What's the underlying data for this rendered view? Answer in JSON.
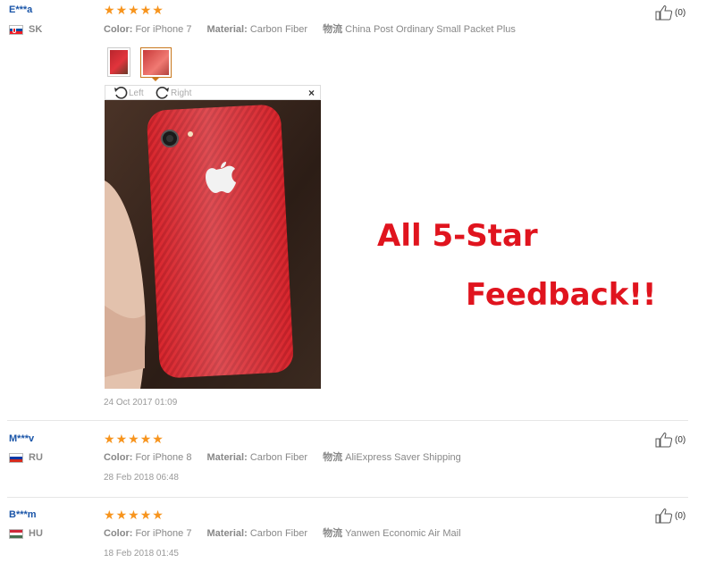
{
  "labels": {
    "color": "Color:",
    "material": "Material:",
    "shipping": "物流",
    "rotate_left": "Left",
    "rotate_right": "Right",
    "close": "×"
  },
  "reviews": [
    {
      "user": "E***a",
      "country_code": "SK",
      "rating": 5,
      "color": "For iPhone 7",
      "material": "Carbon Fiber",
      "shipping": "China Post Ordinary Small Packet Plus",
      "date": "24 Oct 2017 01:09",
      "helpful": "(0)"
    },
    {
      "user": "M***v",
      "country_code": "RU",
      "rating": 5,
      "color": "For iPhone 8",
      "material": "Carbon Fiber",
      "shipping": "AliExpress Saver Shipping",
      "date": "28 Feb 2018 06:48",
      "helpful": "(0)"
    },
    {
      "user": "B***m",
      "country_code": "HU",
      "rating": 5,
      "color": "For iPhone 7",
      "material": "Carbon Fiber",
      "shipping": "Yanwen Economic Air Mail",
      "date": "18 Feb 2018 01:45",
      "helpful": "(0)"
    }
  ],
  "promo": {
    "line1": "All 5-Star",
    "line2": "Feedback!!"
  },
  "colors": {
    "star": "#f7941d",
    "username": "#1a55a8",
    "promo": "#e0141e",
    "phone": "#d8262d"
  },
  "icons": {
    "rating": "star-icon",
    "helpful": "thumbs-up-icon",
    "rotate_left": "rotate-left-icon",
    "rotate_right": "rotate-right-icon",
    "close": "close-icon"
  }
}
